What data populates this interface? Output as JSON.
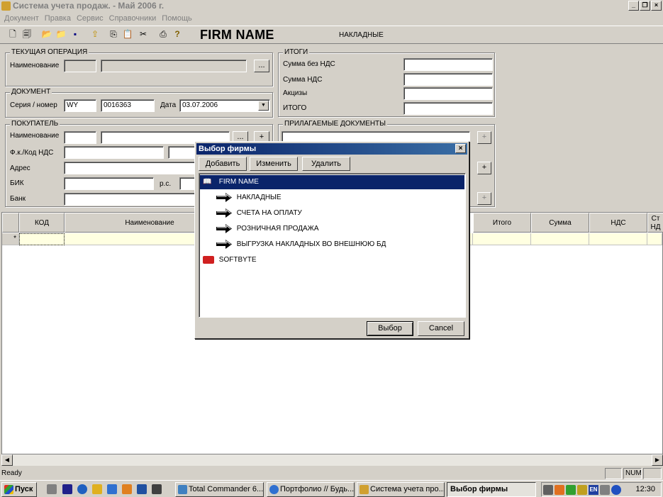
{
  "window": {
    "title": "Система учета продаж. - Май 2006 г.",
    "min": "_",
    "max": "❐",
    "close": "×"
  },
  "menu": [
    "Документ",
    "Правка",
    "Сервис",
    "Справочники",
    "Помощь"
  ],
  "toolbar": {
    "firm_name": "FIRM NAME",
    "section": "НАКЛАДНЫЕ"
  },
  "current_op": {
    "title": "ТЕКУЩАЯ ОПЕРАЦИЯ",
    "name_label": "Наименование",
    "browse": "..."
  },
  "document": {
    "title": "ДОКУМЕНТ",
    "series_label": "Серия / номер",
    "series": "WY",
    "number": "0016363",
    "date_label": "Дата",
    "date": "03.07.2006"
  },
  "buyer": {
    "title": "ПОКУПАТЕЛЬ",
    "name_label": "Наименование",
    "fk_label": "Ф.к./Код НДС",
    "address_label": "Адрес",
    "bik_label": "БИК",
    "rs_label": "р.с.",
    "bank_label": "Банк",
    "browse": "...",
    "add": "+"
  },
  "totals": {
    "title": "ИТОГИ",
    "sum_no_vat": "Сумма без НДС",
    "vat_sum": "Сумма НДС",
    "excise": "Акцизы",
    "total": "ИТОГО"
  },
  "attached": {
    "title": "ПРИЛАГАЕМЫЕ ДОКУМЕНТЫ",
    "add": "+"
  },
  "grid": {
    "columns": [
      "КОД",
      "Наименование",
      "Итого",
      "Сумма",
      "НДС",
      "Ст\nНД"
    ],
    "row_marker": "*"
  },
  "status": {
    "text": "Ready",
    "num": "NUM"
  },
  "taskbar": {
    "start": "Пуск",
    "items": [
      "Total Commander 6....",
      "Портфолио // Будь...",
      "Система учета про...",
      "Выбор фирмы"
    ],
    "lang": "EN",
    "clock": "12:30"
  },
  "dialog": {
    "title": "Выбор фирмы",
    "close": "×",
    "buttons": {
      "add": "Добавить",
      "edit": "Изменить",
      "delete": "Удалить",
      "select": "Выбор",
      "cancel": "Cancel"
    },
    "tree": {
      "root": "FIRM NAME",
      "children": [
        "НАКЛАДНЫЕ",
        "СЧЕТА НА ОПЛАТУ",
        "РОЗНИЧНАЯ ПРОДАЖА",
        "ВЫГРУЗКА НАКЛАДНЫХ ВО ВНЕШНЮЮ БД"
      ],
      "second_root": "SOFTBYTE"
    }
  },
  "colors": {
    "title_active": "#0a246a",
    "selection": "#0a246a",
    "grid_row": "#ffffe1",
    "face": "#d4d0c8"
  }
}
